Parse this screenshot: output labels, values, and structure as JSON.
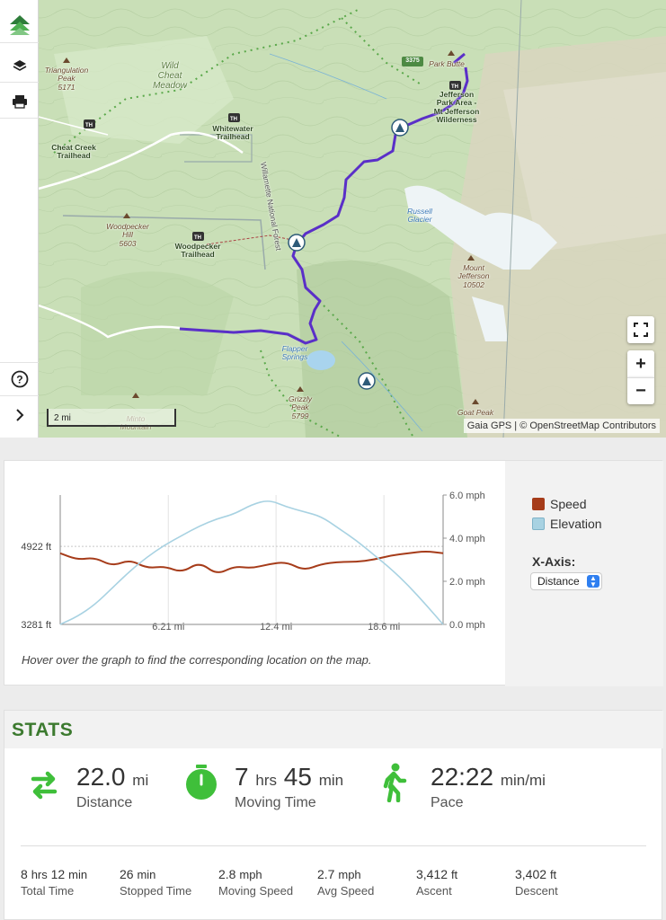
{
  "map": {
    "labels": {
      "triangulation_peak": "Triangulation\nPeak\n5171",
      "wild_cheat_meadow": "Wild\nCheat\nMeadow",
      "whitewater_trailhead": "Whitewater\nTrailhead",
      "cheat_creek_trailhead": "Cheat Creek\nTrailhead",
      "woodpecker_hill": "Woodpecker\nHill\n5603",
      "woodpecker_trailhead": "Woodpecker\nTrailhead",
      "willamette_nf": "Willamette National Forest",
      "jefferson_park": "Jefferson\nPark Area -\nMt Jefferson\nWilderness",
      "park_butte": "Park Butte",
      "russell_glacier": "Russell\nGlacier",
      "mount_jefferson": "Mount\nJefferson\n10502",
      "pamelia_lake": "Flapper\nSprings",
      "grizzly_peak": "Grizzly\nPeak\n5799",
      "goat_peak": "Goat Peak",
      "minto_mountain": "Minto\nMountain",
      "road_badge": "3375"
    },
    "scale_label": "2 mi",
    "attribution": "Gaia GPS | © OpenStreetMap Contributors",
    "controls": {
      "zoom_in": "+",
      "zoom_out": "−"
    }
  },
  "chart_data": {
    "type": "line",
    "x_axis": "Distance",
    "x_unit": "mi",
    "xlim": [
      0,
      22.0
    ],
    "x_ticks": [
      "6.21 mi",
      "12.4 mi",
      "18.6 mi"
    ],
    "y_left_ticks": [
      "4922 ft",
      "3281 ft"
    ],
    "y_left_lim": [
      3281,
      6000
    ],
    "y_right_ticks": [
      "6.0 mph",
      "4.0 mph",
      "2.0 mph",
      "0.0 mph"
    ],
    "y_right_lim": [
      0,
      6.0
    ],
    "series": [
      {
        "name": "Speed",
        "color": "#a63c1a",
        "x": [
          0,
          1,
          2,
          3,
          4,
          5,
          6,
          7,
          8,
          9,
          10,
          11,
          12,
          13,
          14,
          15,
          16,
          17,
          18,
          19,
          20,
          21,
          22
        ],
        "values": [
          3.3,
          3.0,
          3.1,
          2.7,
          3.0,
          2.6,
          2.7,
          2.4,
          2.9,
          2.3,
          2.7,
          2.6,
          2.8,
          2.9,
          2.5,
          2.8,
          2.9,
          2.9,
          3.0,
          3.2,
          3.3,
          3.4,
          3.3
        ]
      },
      {
        "name": "Elevation",
        "color": "#a8d2e2",
        "x": [
          0,
          1,
          2,
          3,
          4,
          5,
          6,
          7,
          8,
          9,
          10,
          11,
          12,
          13,
          14,
          15,
          16,
          17,
          18,
          19,
          20,
          21,
          22
        ],
        "values": [
          3281,
          3450,
          3700,
          4050,
          4400,
          4700,
          4950,
          5150,
          5350,
          5500,
          5600,
          5800,
          5900,
          5750,
          5650,
          5550,
          5300,
          5050,
          4750,
          4450,
          4100,
          3700,
          3281
        ]
      }
    ],
    "legend": [
      "Speed",
      "Elevation"
    ]
  },
  "chart_panel": {
    "x_axis_label": "X-Axis:",
    "x_axis_select": "Distance",
    "hint": "Hover over the graph to find the corresponding location on the map."
  },
  "stats": {
    "title": "STATS",
    "distance": {
      "value": "22.0",
      "unit": "mi",
      "label": "Distance"
    },
    "moving_time": {
      "hrs": "7",
      "hrs_unit": "hrs",
      "min": "45",
      "min_unit": "min",
      "label": "Moving Time"
    },
    "pace": {
      "value": "22:22",
      "unit": "min/mi",
      "label": "Pace"
    },
    "details": [
      {
        "value": "8",
        "unit": "hrs",
        "value2": "12",
        "unit2": "min",
        "label": "Total Time"
      },
      {
        "value": "26",
        "unit": "min",
        "label": "Stopped Time"
      },
      {
        "value": "2.8",
        "unit": "mph",
        "label": "Moving Speed"
      },
      {
        "value": "2.7",
        "unit": "mph",
        "label": "Avg Speed"
      },
      {
        "value": "3,412",
        "unit": "ft",
        "label": "Ascent"
      },
      {
        "value": "3,402",
        "unit": "ft",
        "label": "Descent"
      }
    ]
  }
}
